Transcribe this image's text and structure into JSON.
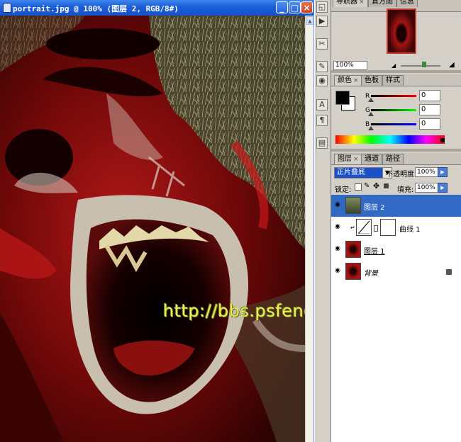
{
  "document": {
    "title": "portrait.jpg @ 100% (图层 2, RGB/8#)",
    "watermark": "http://bbs.psfeng.cn/"
  },
  "toolbar": {
    "buttons": [
      "navigator-icon",
      "actions-icon",
      "tool-presets-icon",
      "brushes-icon",
      "clone-source-icon",
      "character-icon",
      "paragraph-icon",
      "layer-comps-icon"
    ]
  },
  "navigator_panel": {
    "tabs": [
      "导航器",
      "直方图",
      "信息"
    ],
    "zoom_value": "100%"
  },
  "color_panel": {
    "tabs": [
      "颜色",
      "色板",
      "样式"
    ],
    "channels": [
      {
        "label": "R",
        "value": "0"
      },
      {
        "label": "G",
        "value": "0"
      },
      {
        "label": "B",
        "value": "0"
      }
    ],
    "colors": {
      "foreground": "#000000",
      "background": "#ffffff"
    }
  },
  "layers_panel": {
    "tabs": [
      "图层",
      "通道",
      "路径"
    ],
    "blend_mode": "正片叠底",
    "opacity_label": "不透明度:",
    "opacity_value": "100%",
    "lock_label": "锁定:",
    "fill_label": "填充:",
    "fill_value": "100%",
    "layers": [
      {
        "name": "图层 2",
        "selected": true
      },
      {
        "name": "曲线 1",
        "selected": false
      },
      {
        "name": "图层 1",
        "selected": false
      },
      {
        "name": "背景",
        "selected": false
      }
    ]
  }
}
